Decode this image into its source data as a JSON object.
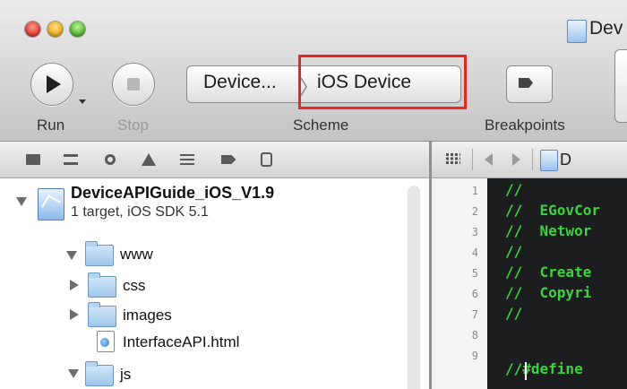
{
  "window": {
    "title": "Dev"
  },
  "toolbar": {
    "run_label": "Run",
    "stop_label": "Stop",
    "scheme_label": "Scheme",
    "breakpoints_label": "Breakpoints",
    "scheme": {
      "target": "Device...",
      "separator": "〉",
      "device": "iOS Device"
    }
  },
  "jump_bar": {
    "label": "D"
  },
  "navigator": {
    "project": {
      "name": "DeviceAPIGuide_iOS_V1.9",
      "subtitle": "1 target, iOS SDK 5.1"
    },
    "items": [
      {
        "label": "www",
        "expanded": true
      },
      {
        "label": "css",
        "expanded": false
      },
      {
        "label": "images",
        "expanded": false
      },
      {
        "label": "InterfaceAPI.html"
      },
      {
        "label": "js",
        "expanded": true
      }
    ]
  },
  "editor": {
    "line_numbers": [
      "1",
      "2",
      "3",
      "4",
      "5",
      "6",
      "7",
      "8",
      "9"
    ],
    "lines": [
      "//",
      "//  EGovCor",
      "//  Networ",
      "//",
      "//  Create",
      "//  Copyri",
      "//",
      "",
      "//#define"
    ]
  },
  "colors": {
    "highlight": "#e8261d",
    "code_comment": "#3ed33e",
    "editor_bg": "#1b1d1e"
  }
}
